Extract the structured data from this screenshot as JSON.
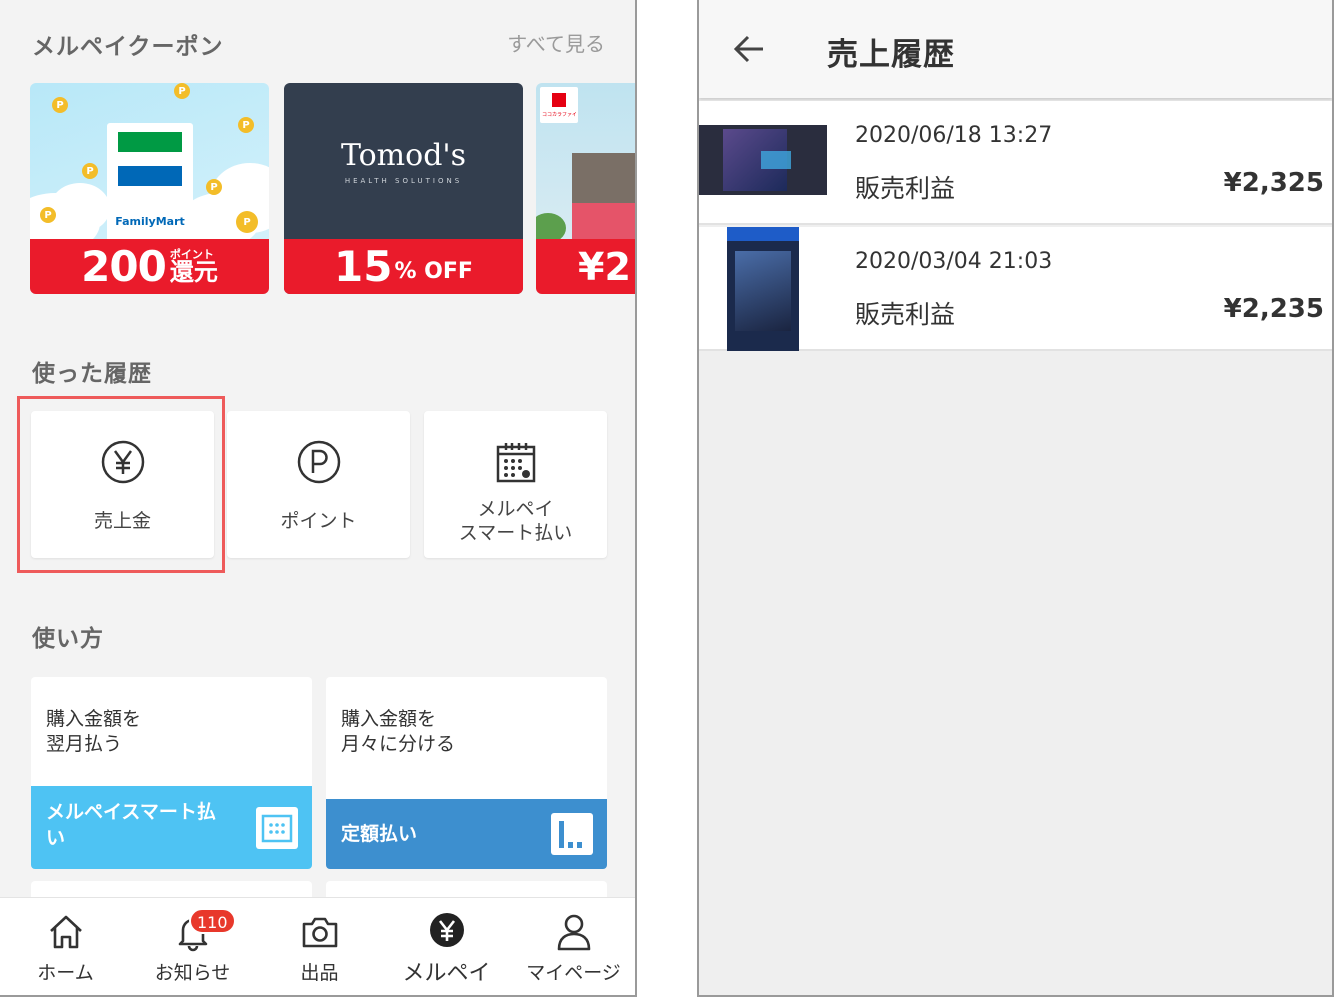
{
  "left": {
    "coupons": {
      "title": "メルペイクーポン",
      "see_all": "すべて見る",
      "items": [
        {
          "brand": "FamilyMart",
          "offer_number": "200",
          "offer_small": "ポイント",
          "offer_suffix": "還元",
          "band_color": "#ea1b2b"
        },
        {
          "brand": "Tomod's",
          "brand_sub": "HEALTH SOLUTIONS",
          "offer_number": "15",
          "offer_suffix": "% OFF",
          "band_color": "#ea1b2b"
        },
        {
          "brand": "ココカラファイン",
          "offer_number": "¥2",
          "band_color": "#ea1b2b"
        }
      ]
    },
    "history": {
      "title": "使った履歴",
      "tiles": [
        {
          "label": "売上金",
          "icon": "yen-circle-icon"
        },
        {
          "label": "ポイント",
          "icon": "p-circle-icon"
        },
        {
          "label_line1": "メルペイ",
          "label_line2": "スマート払い",
          "icon": "calendar-icon"
        }
      ]
    },
    "howto": {
      "title": "使い方",
      "cards": [
        {
          "line1": "購入金額を",
          "line2": "翌月払う",
          "bar_line1": "メルペイスマート払",
          "bar_line2": "い",
          "bar_color": "#4ec3f3"
        },
        {
          "line1": "購入金額を",
          "line2": "月々に分ける",
          "bar_line1": "定額払い",
          "bar_color": "#3d8fcf"
        }
      ]
    },
    "nav": [
      {
        "label": "ホーム",
        "icon": "home-icon"
      },
      {
        "label": "お知らせ",
        "icon": "bell-icon",
        "badge": "110"
      },
      {
        "label": "出品",
        "icon": "camera-icon"
      },
      {
        "label": "メルペイ",
        "icon": "yen-filled-icon"
      },
      {
        "label": "マイページ",
        "icon": "person-icon"
      }
    ]
  },
  "right": {
    "title": "売上履歴",
    "rows": [
      {
        "datetime": "2020/06/18 13:27",
        "type": "販売利益",
        "amount": "¥2,325"
      },
      {
        "datetime": "2020/03/04 21:03",
        "type": "販売利益",
        "amount": "¥2,235"
      }
    ]
  },
  "colors": {
    "accent_red": "#ea1b2b",
    "highlight": "#ee5a5a",
    "badge": "#e8382b"
  }
}
